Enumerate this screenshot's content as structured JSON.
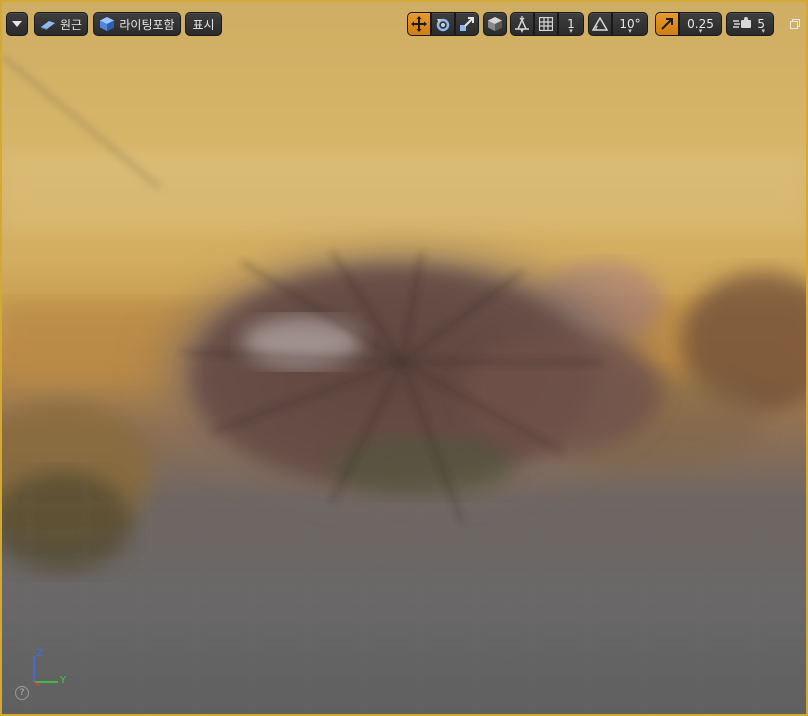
{
  "toolbar": {
    "perspective_label": "원근",
    "lighting_label": "라이팅포함",
    "show_label": "표시",
    "grid_snap_value": "1",
    "rotation_snap_value": "10°",
    "scale_snap_value": "0.25",
    "camera_speed_value": "5"
  },
  "axis": {
    "z_label": "Z",
    "y_label": "Y"
  },
  "help": {
    "label": "?"
  },
  "colors": {
    "accent": "#e89a2e",
    "frame_border": "#d2a935",
    "axis_x": "#e23a3a",
    "axis_y": "#3fcf3f",
    "axis_z": "#3a6bff"
  }
}
